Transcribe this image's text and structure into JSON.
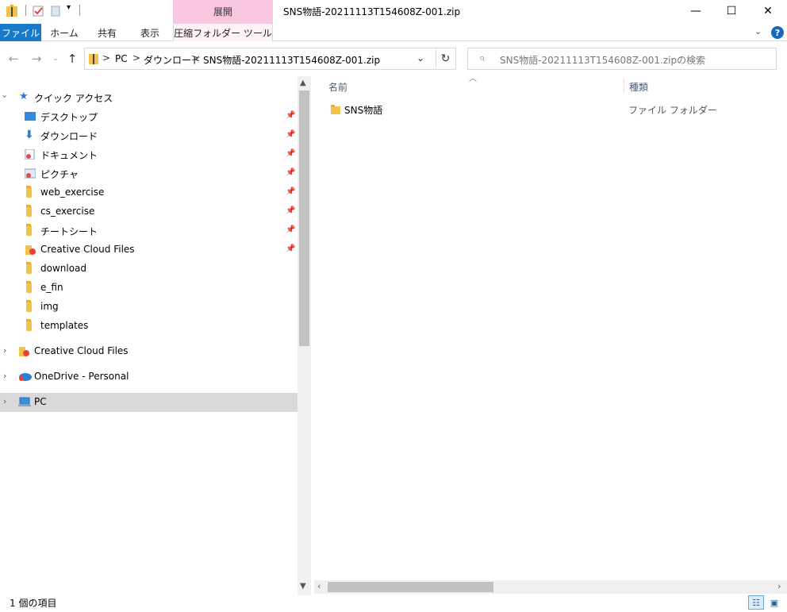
{
  "window": {
    "title": "SNS物語-20211113T154608Z-001.zip",
    "context_group": "展開",
    "minimize": "—",
    "maximize": "☐",
    "close": "✕"
  },
  "ribbon": {
    "tabs": [
      "ファイル",
      "ホーム",
      "共有",
      "表示",
      "圧縮フォルダー ツール"
    ],
    "collapse_icon": "chevron-down-icon",
    "help": "?"
  },
  "address": {
    "crumbs": [
      "PC",
      "ダウンロード",
      "SNS物語-20211113T154608Z-001.zip"
    ],
    "separator": ">",
    "search_placeholder": "SNS物語-20211113T154608Z-001.zipの検索"
  },
  "nav": {
    "quick_access": "クイック アクセス",
    "items": [
      {
        "label": "デスクトップ",
        "icon": "desktop-icon",
        "pinned": true
      },
      {
        "label": "ダウンロード",
        "icon": "download-arrow-icon",
        "pinned": true
      },
      {
        "label": "ドキュメント",
        "icon": "documents-icon",
        "pinned": true
      },
      {
        "label": "ピクチャ",
        "icon": "pictures-icon",
        "pinned": true
      },
      {
        "label": "web_exercise",
        "icon": "folder-icon",
        "pinned": true
      },
      {
        "label": "cs_exercise",
        "icon": "folder-icon",
        "pinned": true
      },
      {
        "label": "チートシート",
        "icon": "folder-icon",
        "pinned": true
      },
      {
        "label": "Creative Cloud Files",
        "icon": "creative-cloud-folder-icon",
        "pinned": true
      },
      {
        "label": "download",
        "icon": "folder-icon",
        "pinned": false
      },
      {
        "label": "e_fin",
        "icon": "folder-icon",
        "pinned": false
      },
      {
        "label": "img",
        "icon": "folder-icon",
        "pinned": false
      },
      {
        "label": "templates",
        "icon": "folder-icon",
        "pinned": false
      }
    ],
    "roots": [
      {
        "label": "Creative Cloud Files",
        "icon": "creative-cloud-folder-icon"
      },
      {
        "label": "OneDrive - Personal",
        "icon": "onedrive-icon"
      },
      {
        "label": "PC",
        "icon": "pc-icon",
        "selected": true
      }
    ]
  },
  "content": {
    "columns": [
      "名前",
      "種類"
    ],
    "rows": [
      {
        "name": "SNS物語",
        "type": "ファイル フォルダー",
        "icon": "folder-icon"
      }
    ]
  },
  "status": {
    "item_count": "1 個の項目"
  },
  "colors": {
    "file_tab": "#1979ca",
    "context_tab": "#f9c6e0",
    "folder": "#f3c24c",
    "selection": "#d9d9d9"
  }
}
